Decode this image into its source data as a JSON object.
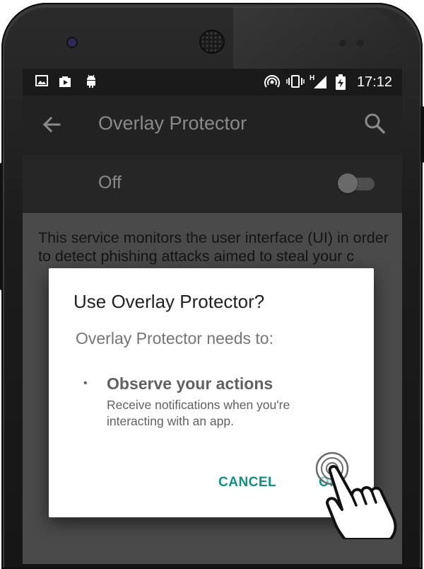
{
  "status_bar": {
    "left_icons": [
      "image-icon",
      "store-bag-icon",
      "android-icon"
    ],
    "right_icons": [
      "hotspot-icon",
      "vibrate-icon",
      "signal-icon",
      "battery-charging-icon"
    ],
    "network_type": "H",
    "time": "17:12"
  },
  "toolbar": {
    "title": "Overlay Protector",
    "back_icon": "arrow-back-icon",
    "search_icon": "search-icon"
  },
  "switch_bar": {
    "label": "Off",
    "enabled": false
  },
  "content": {
    "description": "This service monitors the user interface (UI) in order to detect phishing attacks aimed to steal your c"
  },
  "dialog": {
    "title": "Use Overlay Protector?",
    "subtitle": "Overlay Protector needs to:",
    "permission": {
      "title": "Observe your actions",
      "description": "Receive notifications when you're interacting with an app."
    },
    "cancel_label": "CANCEL",
    "ok_label": "OK"
  },
  "colors": {
    "accent": "#0a9481",
    "statusbar": "#1a1a1a",
    "toolbar": "#222222",
    "scrim": "#4a4a4a",
    "dialog": "#ffffff"
  }
}
